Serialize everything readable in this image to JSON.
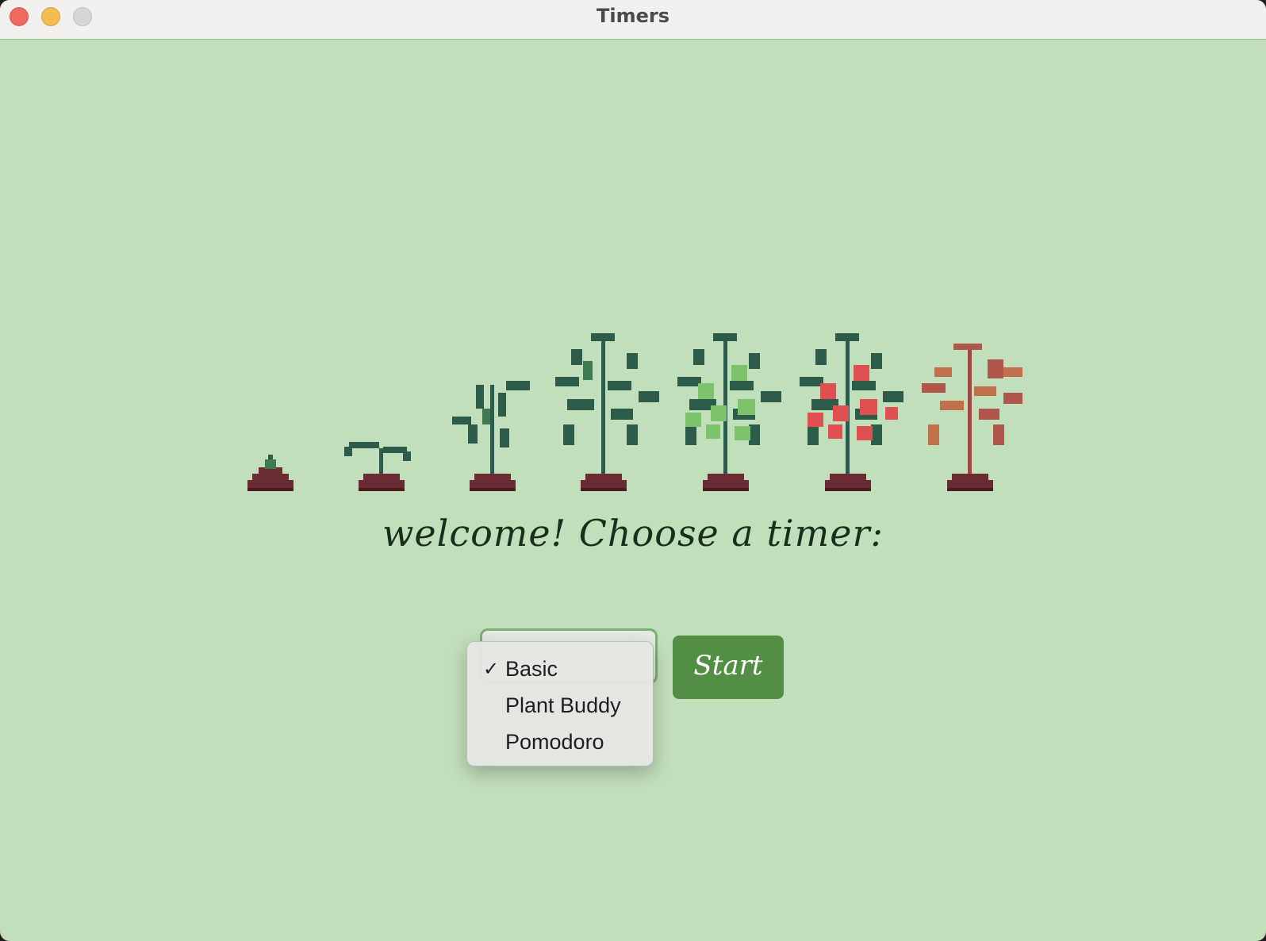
{
  "window": {
    "title": "Timers"
  },
  "main": {
    "welcome_text": "welcome! Choose a timer:",
    "plant_stages": [
      "seed-icon",
      "sprout-icon",
      "young-plant-icon",
      "leafy-plant-icon",
      "green-fruit-plant-icon",
      "ripe-tomato-plant-icon",
      "withered-plant-icon"
    ]
  },
  "timer_select": {
    "selected_value": "Basic",
    "options": [
      "Basic",
      "Plant Buddy",
      "Pomodoro"
    ],
    "checkmark": "✓"
  },
  "start_button": {
    "label": "Start"
  },
  "colors": {
    "background": "#c2dfbb",
    "button": "#528f44",
    "leaf": "#2e5c4a",
    "soil": "#6b2b33",
    "green_fruit": "#7cc36b",
    "red_fruit": "#e05050",
    "withered": "#b0564a"
  }
}
